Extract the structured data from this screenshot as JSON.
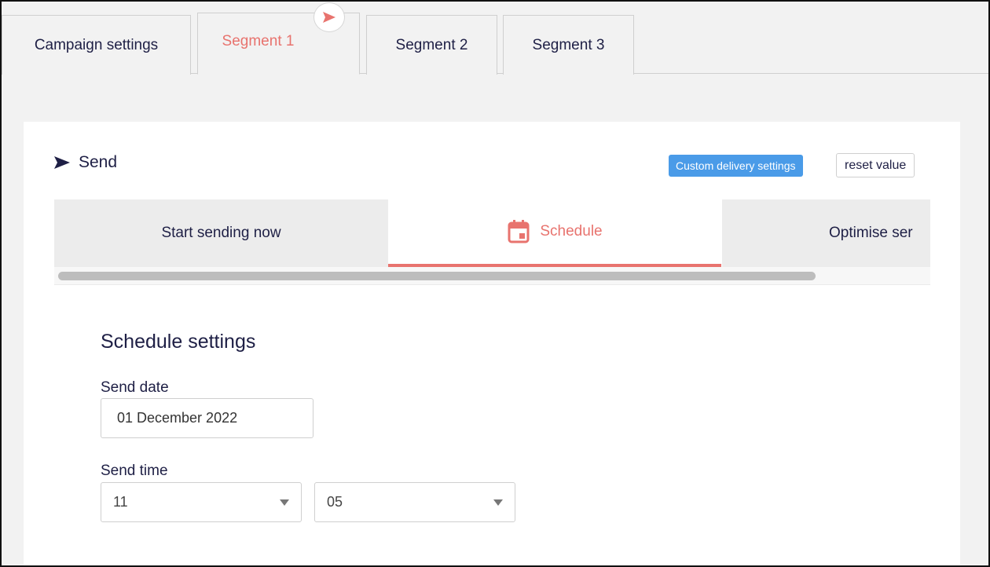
{
  "tabs": [
    {
      "label": "Campaign settings",
      "active": false
    },
    {
      "label": "Segment 1",
      "active": true
    },
    {
      "label": "Segment 2",
      "active": false
    },
    {
      "label": "Segment 3",
      "active": false
    }
  ],
  "active_tab_icon": "send-icon",
  "send": {
    "title": "Send",
    "custom_badge": "Custom delivery settings",
    "reset_label": "reset value"
  },
  "delivery_options": [
    {
      "label": "Start sending now",
      "active": false
    },
    {
      "label": "Schedule",
      "active": true,
      "icon": "calendar-icon"
    },
    {
      "label": "Optimise ser",
      "active": false
    }
  ],
  "schedule": {
    "title": "Schedule settings",
    "send_date_label": "Send date",
    "send_date_value": "01 December 2022",
    "send_time_label": "Send time",
    "hour_value": "11",
    "minute_value": "05"
  },
  "colors": {
    "accent": "#e8736e",
    "badge": "#4a9be8",
    "text": "#1e1f45"
  }
}
